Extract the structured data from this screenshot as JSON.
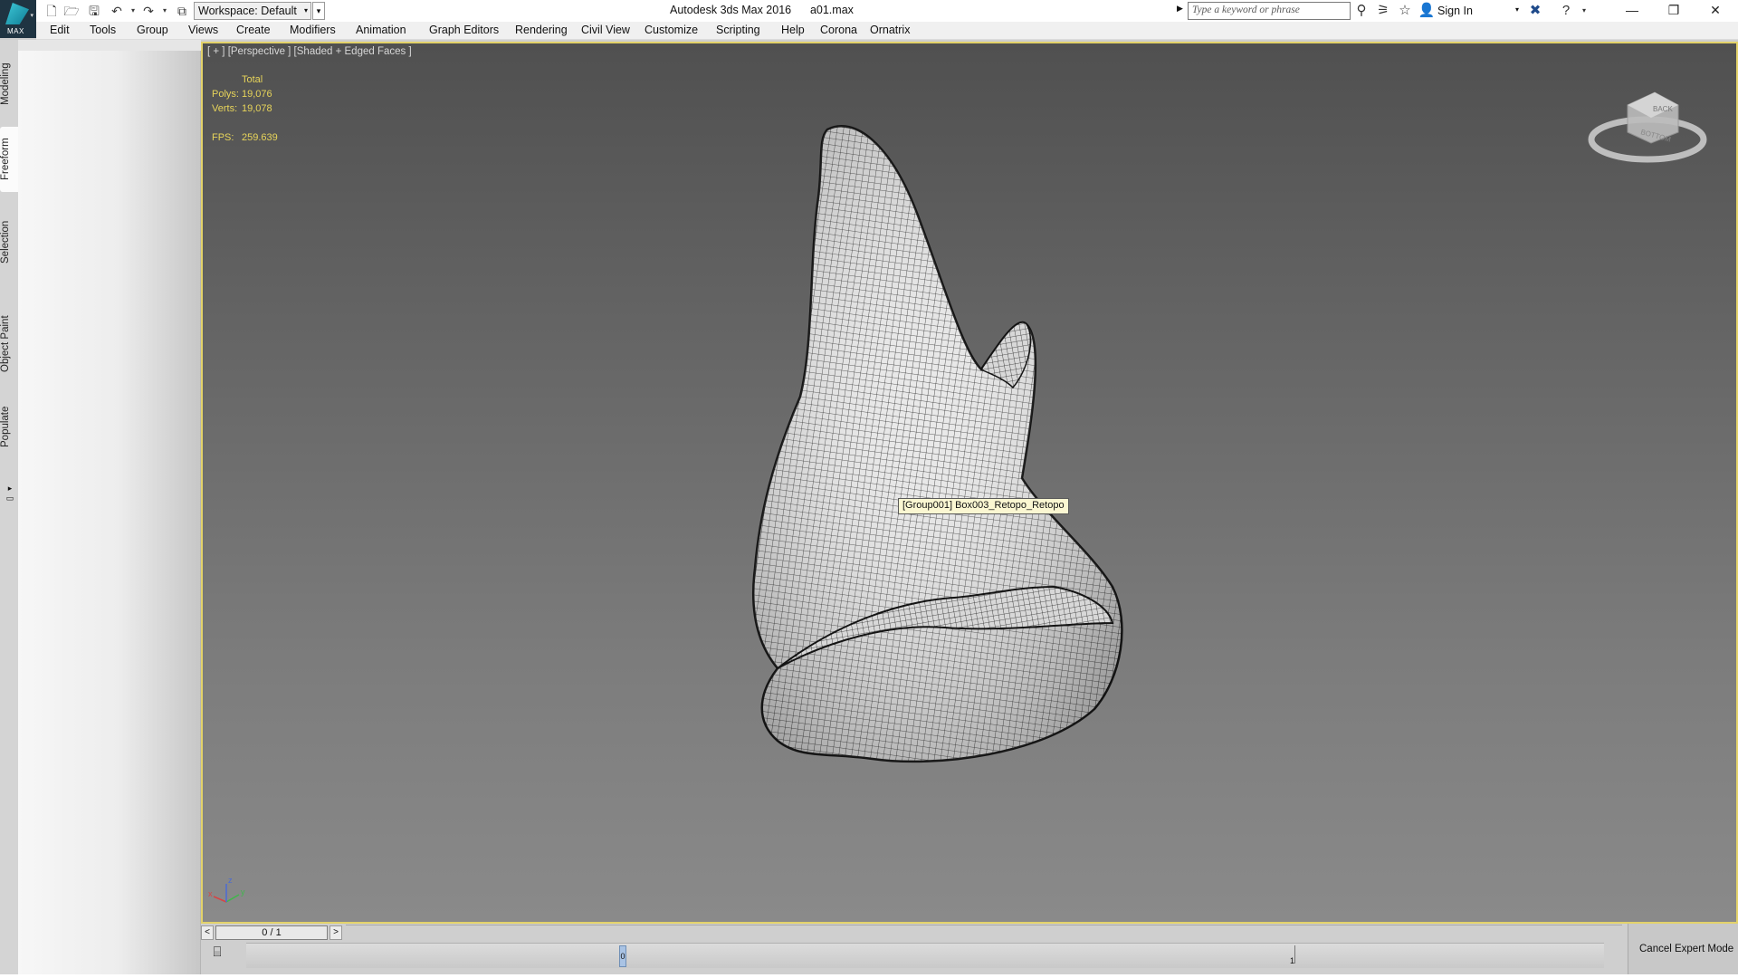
{
  "app": {
    "logo_text": "MAX",
    "window_title": "Autodesk 3ds Max 2016      a01.max",
    "workspace_label": "Workspace: Default",
    "search_placeholder": "Type a keyword or phrase",
    "sign_in_label": "Sign In"
  },
  "quick_access": [
    "new-file-icon",
    "open-file-icon",
    "save-icon",
    "undo-icon",
    "redo-icon",
    "project-folder-icon"
  ],
  "menu": [
    "Edit",
    "Tools",
    "Group",
    "Views",
    "Create",
    "Modifiers",
    "Animation",
    "Graph Editors",
    "Rendering",
    "Civil View",
    "Customize",
    "Scripting",
    "Help",
    "Corona",
    "Ornatrix"
  ],
  "ribbon_tabs": [
    {
      "label": "Modeling",
      "active": false
    },
    {
      "label": "Freeform",
      "active": true
    },
    {
      "label": "Selection",
      "active": false
    },
    {
      "label": "Object Paint",
      "active": false
    },
    {
      "label": "Populate",
      "active": false
    }
  ],
  "viewport": {
    "label": "[ + ] [Perspective ] [Shaded + Edged Faces ]",
    "stats": {
      "header": "Total",
      "polys_label": "Polys:",
      "polys_value": "19,076",
      "verts_label": "Verts:",
      "verts_value": "19,078",
      "fps_label": "FPS:",
      "fps_value": "259.639"
    },
    "tooltip": "[Group001] Box003_Retopo_Retopo",
    "viewcube_faces": [
      "BACK",
      "BOTTOM"
    ],
    "axis_labels": [
      "x",
      "y",
      "z"
    ],
    "border_color": "#e3d26a"
  },
  "timeline": {
    "frame_display": "0 / 1",
    "prev_label": "<",
    "next_label": ">",
    "marker_label": "0",
    "tick_label": "1"
  },
  "expert_mode": {
    "cancel_label": "Cancel Expert Mode"
  }
}
